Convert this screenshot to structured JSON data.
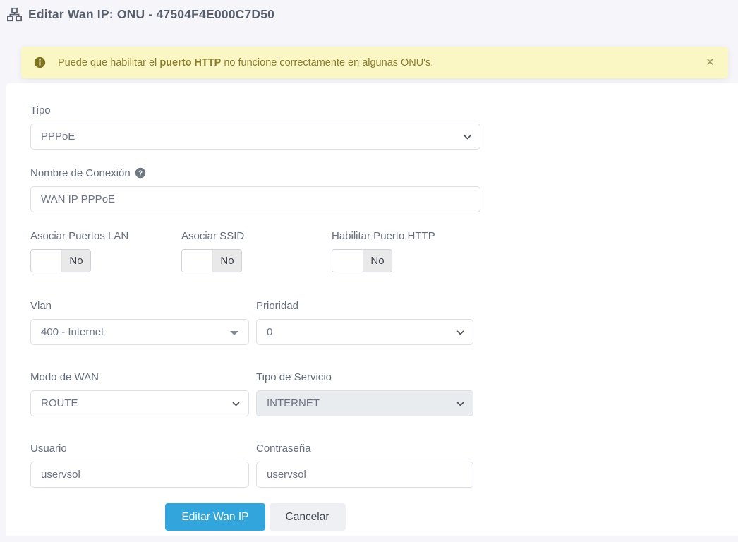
{
  "header": {
    "icon": "sitemap-icon",
    "title": "Editar Wan IP: ONU - 47504F4E000C7D50"
  },
  "alert": {
    "icon": "info-circle-icon",
    "text_prefix": "Puede que habilitar el ",
    "text_bold": "puerto HTTP",
    "text_suffix": " no funcione correctamente en algunas ONU's.",
    "close_label": "×"
  },
  "form": {
    "tipo": {
      "label": "Tipo",
      "value": "PPPoE"
    },
    "nombre_conexion": {
      "label": "Nombre de Conexión",
      "help_icon": "question-circle-icon",
      "value": "WAN IP PPPoE"
    },
    "toggles": [
      {
        "label": "Asociar Puertos LAN",
        "state": "No"
      },
      {
        "label": "Asociar SSID",
        "state": "No"
      },
      {
        "label": "Habilitar Puerto HTTP",
        "state": "No"
      }
    ],
    "vlan": {
      "label": "Vlan",
      "value": "400 - Internet"
    },
    "prioridad": {
      "label": "Prioridad",
      "value": "0"
    },
    "modo_wan": {
      "label": "Modo de WAN",
      "value": "ROUTE"
    },
    "tipo_servicio": {
      "label": "Tipo de Servicio",
      "value": "INTERNET",
      "disabled": true
    },
    "usuario": {
      "label": "Usuario",
      "value": "uservsol"
    },
    "contrasena": {
      "label": "Contraseña",
      "value": "uservsol"
    },
    "buttons": {
      "submit": "Editar Wan IP",
      "cancel": "Cancelar"
    }
  },
  "colors": {
    "page_background": "#f5f5fa",
    "alert_background": "#fbf7c5",
    "alert_text": "#8a7d2e",
    "primary_button": "#32a6dc",
    "disabled_field_background": "#e9ecef",
    "title_text": "#575f6d",
    "label_text": "#646d7d"
  }
}
